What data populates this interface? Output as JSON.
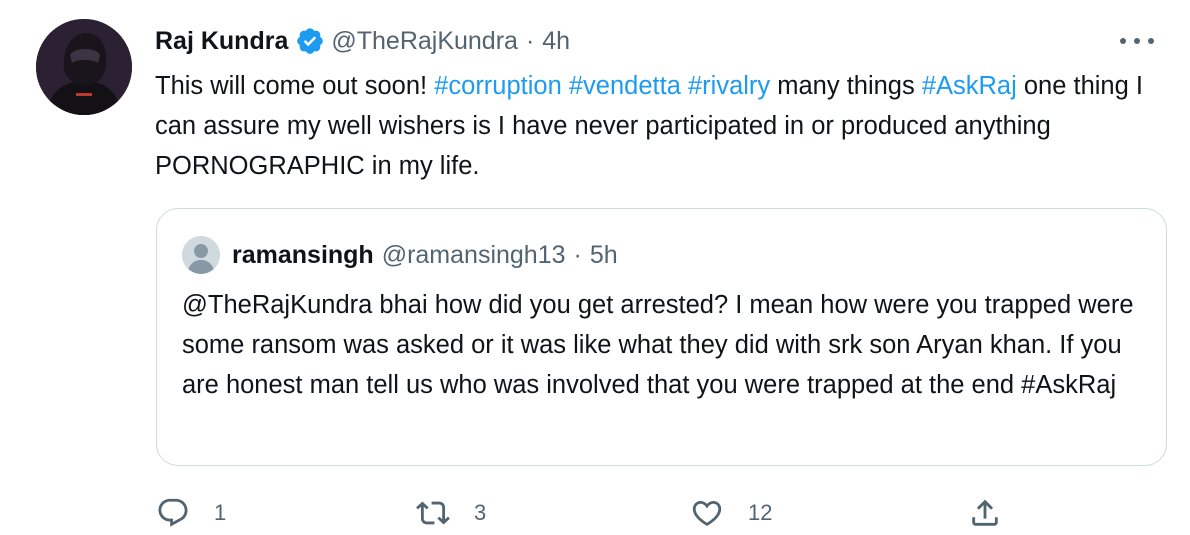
{
  "tweet": {
    "author_name": "Raj Kundra",
    "author_handle": "@TheRajKundra",
    "separator": "·",
    "time": "4h",
    "text_parts": [
      {
        "text": "This will come out soon! ",
        "hashtag": false
      },
      {
        "text": "#corruption",
        "hashtag": true
      },
      {
        "text": " ",
        "hashtag": false
      },
      {
        "text": "#vendetta",
        "hashtag": true
      },
      {
        "text": " ",
        "hashtag": false
      },
      {
        "text": "#rivalry",
        "hashtag": true
      },
      {
        "text": " many things ",
        "hashtag": false
      },
      {
        "text": "#AskRaj",
        "hashtag": true
      },
      {
        "text": " one thing I can assure my well wishers is I have never participated in or produced anything PORNOGRAPHIC in my life.",
        "hashtag": false
      }
    ],
    "verified": true,
    "accent_color": "#1d9bf0"
  },
  "quote": {
    "author_name": "ramansingh",
    "author_handle": "@ramansingh13",
    "separator": "·",
    "time": "5h",
    "text": "@TheRajKundra bhai how did you get arrested? I mean how were you trapped were some ransom was asked or it was like what they did with srk son Aryan khan. If you are honest man tell us who was involved that you were trapped at the end #AskRaj"
  },
  "actions": {
    "reply": {
      "icon": "reply-icon",
      "count": "1"
    },
    "retweet": {
      "icon": "retweet-icon",
      "count": "3"
    },
    "like": {
      "icon": "heart-icon",
      "count": "12"
    },
    "share": {
      "icon": "share-icon"
    }
  },
  "colors": {
    "text": "#0f1419",
    "secondary": "#536471",
    "border": "#cfd9de"
  }
}
